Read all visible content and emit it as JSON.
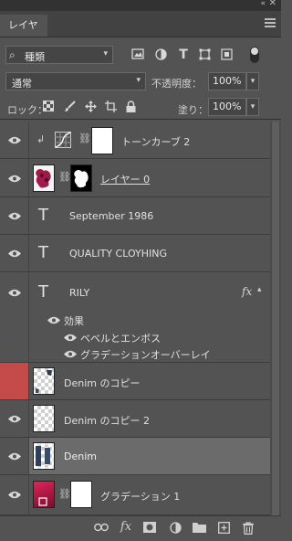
{
  "panel": {
    "collapse_icon": "«",
    "close_icon": "✕",
    "tab_label": "レイヤー",
    "tab_close": "×"
  },
  "filter": {
    "kind_label": "種類",
    "icons": [
      "pixel-filter-icon",
      "adjustment-filter-icon",
      "type-filter-icon",
      "shape-filter-icon",
      "smartobject-filter-icon"
    ]
  },
  "blending": {
    "mode": "通常",
    "opacity_label": "不透明度：",
    "opacity_value": "100%",
    "lock_label": "ロック：",
    "fill_label": "塗り：",
    "fill_value": "100%"
  },
  "layers": [
    {
      "name": "トーンカーブ 2",
      "type": "adjustment"
    },
    {
      "name": "レイヤー 0",
      "type": "masked"
    },
    {
      "name": "September 1986",
      "type": "text"
    },
    {
      "name": "QUALITY CLOYHING",
      "type": "text"
    },
    {
      "name": "RILY",
      "type": "text",
      "fx": "fx",
      "effects_label": "効果",
      "effects": [
        "ベベルとエンボス",
        "グラデーションオーバーレイ"
      ]
    },
    {
      "name": "Denim のコピー",
      "type": "pixel"
    },
    {
      "name": "Denim のコピー 2",
      "type": "pixel"
    },
    {
      "name": "Denim",
      "type": "pixel",
      "selected": true
    },
    {
      "name": "グラデーション 1",
      "type": "fill"
    }
  ],
  "bottom_icons": [
    "link-layers-icon",
    "add-style-icon",
    "add-mask-icon",
    "new-adjustment-icon",
    "new-group-icon",
    "new-layer-icon",
    "delete-layer-icon"
  ],
  "fx_glyph": "fx",
  "text_glyph": "T",
  "colors": {
    "panel": "#535353",
    "selected": "#6b6b6b",
    "eye_highlight": "#c54a4a"
  }
}
